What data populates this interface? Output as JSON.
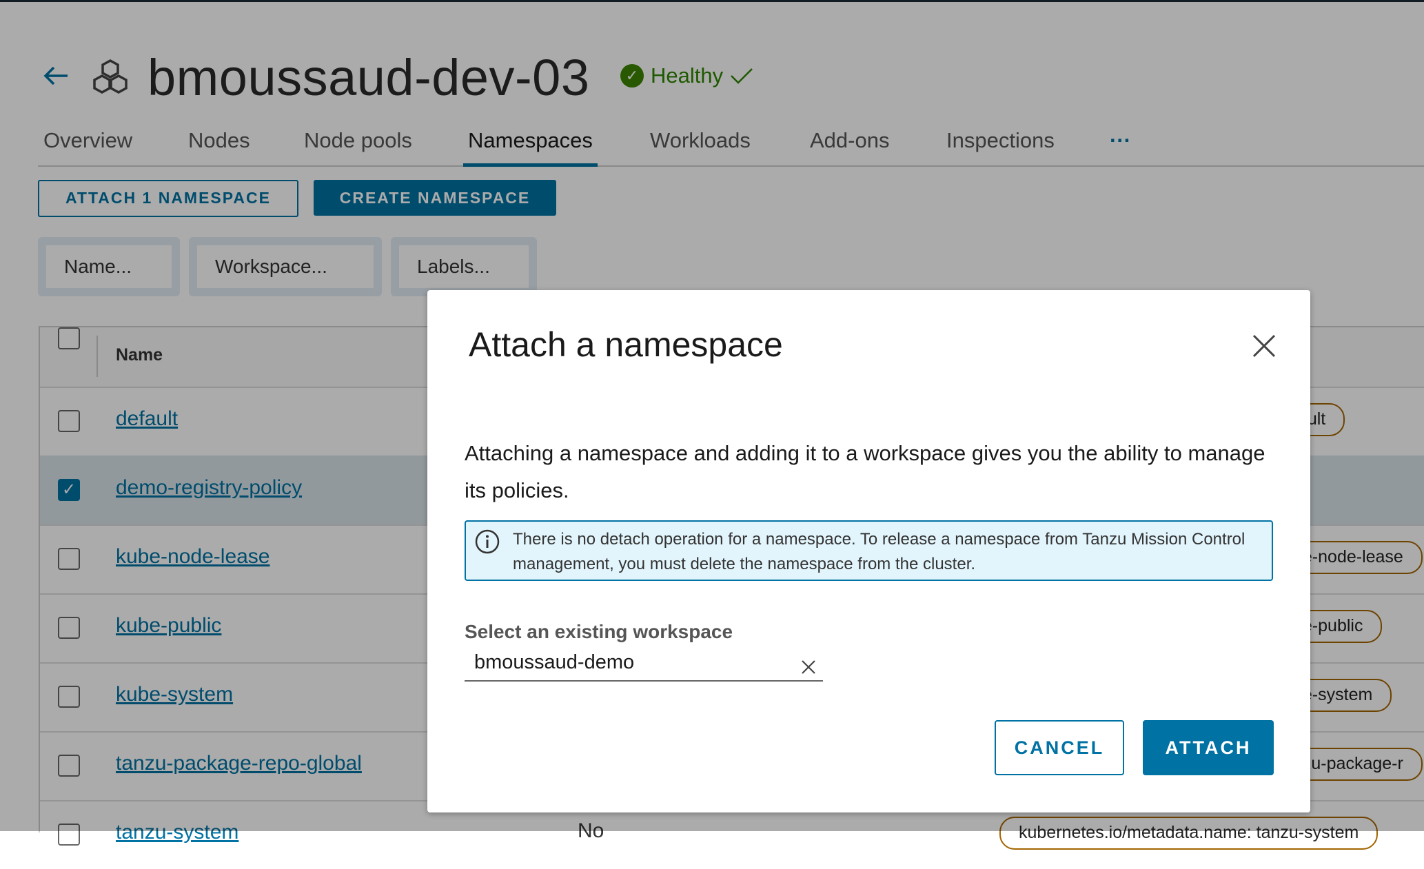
{
  "header": {
    "title": "bmoussaud-dev-03",
    "status": "Healthy",
    "back_icon": "arrow-left-icon",
    "cluster_icon": "cluster-icon"
  },
  "tabs": [
    {
      "label": "Overview"
    },
    {
      "label": "Nodes"
    },
    {
      "label": "Node pools"
    },
    {
      "label": "Namespaces",
      "active": true
    },
    {
      "label": "Workloads"
    },
    {
      "label": "Add-ons"
    },
    {
      "label": "Inspections"
    },
    {
      "label": "···"
    }
  ],
  "actions": {
    "attach_label": "ATTACH 1 NAMESPACE",
    "create_label": "CREATE NAMESPACE"
  },
  "filters": {
    "name_label": "Name...",
    "workspace_label": "Workspace...",
    "labels_label": "Labels..."
  },
  "table": {
    "column_name": "Name",
    "rows": [
      {
        "name": "default",
        "label": "fault",
        "checked": false
      },
      {
        "name": "demo-registry-policy",
        "label": "",
        "checked": true
      },
      {
        "name": "kube-node-lease",
        "label": "be-node-lease",
        "checked": false
      },
      {
        "name": "kube-public",
        "label": "be-public",
        "checked": false
      },
      {
        "name": "kube-system",
        "label": "be-system",
        "checked": false
      },
      {
        "name": "tanzu-package-repo-global",
        "label": "nzu-package-r",
        "checked": false
      },
      {
        "name": "tanzu-system",
        "managed": "No",
        "label": "kubernetes.io/metadata.name: tanzu-system",
        "checked": false
      }
    ]
  },
  "modal": {
    "title": "Attach a namespace",
    "description": "Attaching a namespace and adding it to a workspace gives you the ability to manage its policies.",
    "info": "There is no detach operation for a namespace. To release a namespace from Tanzu Mission Control management, you must delete the namespace from the cluster.",
    "workspace_label": "Select an existing workspace",
    "workspace_value": "bmoussaud-demo",
    "cancel_label": "CANCEL",
    "attach_label": "ATTACH"
  },
  "colors": {
    "accent": "#0072a3",
    "success": "#2e8500",
    "info_bg": "#e3f5fc",
    "label_border": "#a36500"
  }
}
